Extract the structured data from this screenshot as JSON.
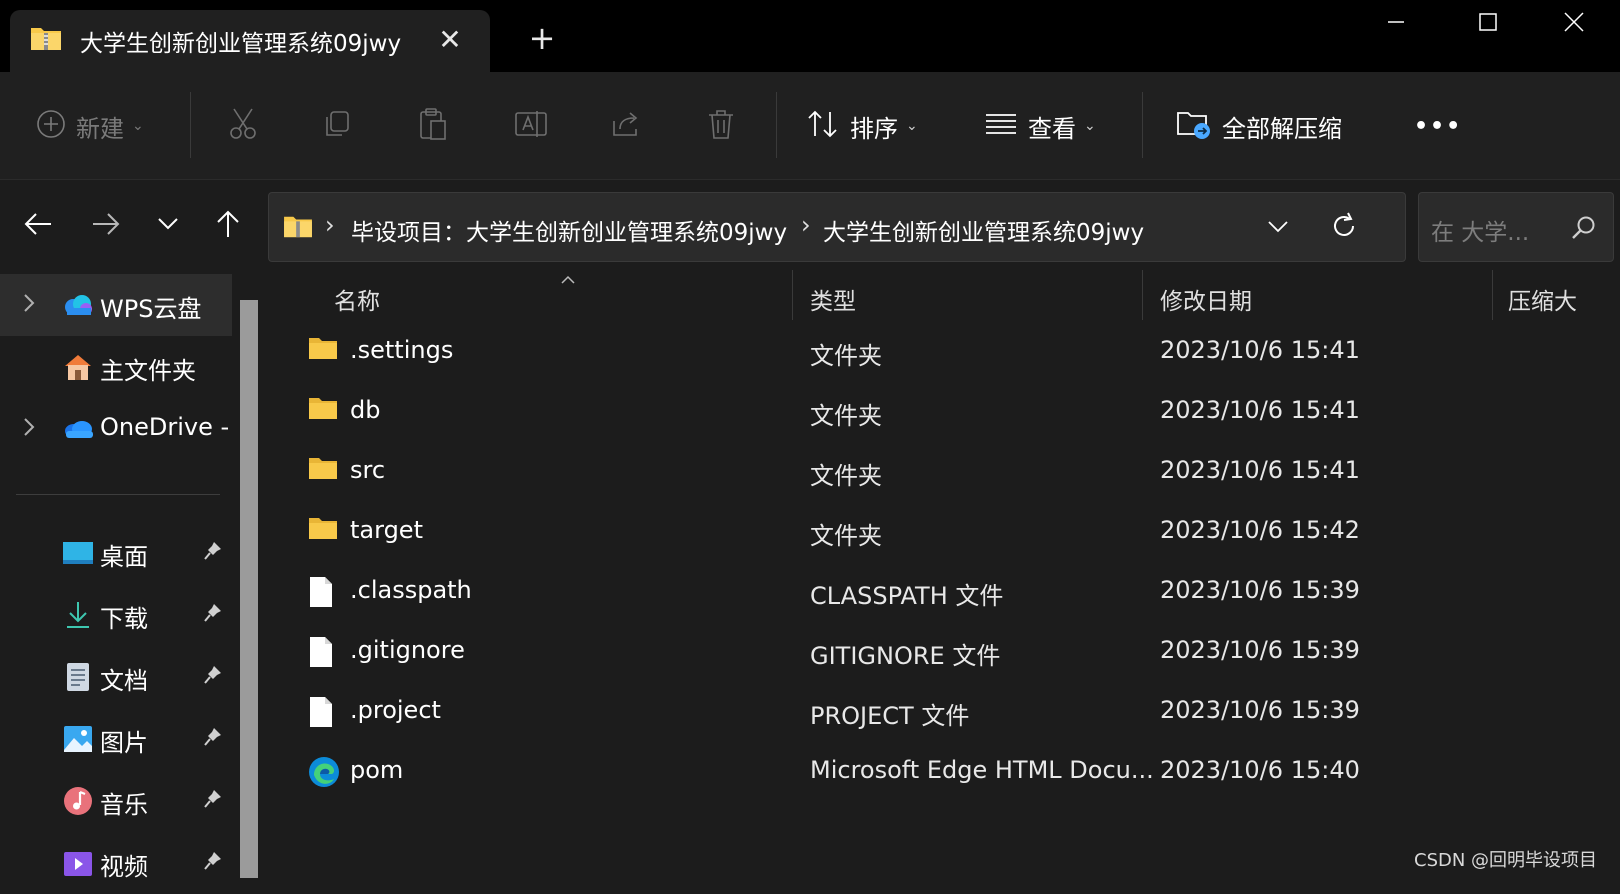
{
  "window": {
    "tab_title": "大学生创新创业管理系统09jwy",
    "tab_close": "✕",
    "new_tab": "+"
  },
  "toolbar": {
    "new_label": "新建",
    "sort_label": "排序",
    "view_label": "查看",
    "extract_label": "全部解压缩",
    "more_label": "•••"
  },
  "address": {
    "crumbs": [
      "毕设项目：大学生创新创业管理系统09jwy",
      "大学生创新创业管理系统09jwy"
    ],
    "separator": "›",
    "search_placeholder": "在 大学..."
  },
  "sidebar": {
    "items": [
      {
        "label": "WPS云盘",
        "icon": "wps-cloud-icon"
      },
      {
        "label": "主文件夹",
        "icon": "home-icon"
      },
      {
        "label": "OneDrive -",
        "icon": "onedrive-icon"
      },
      {
        "label": "桌面",
        "icon": "desktop-icon"
      },
      {
        "label": "下载",
        "icon": "download-icon"
      },
      {
        "label": "文档",
        "icon": "documents-icon"
      },
      {
        "label": "图片",
        "icon": "pictures-icon"
      },
      {
        "label": "音乐",
        "icon": "music-icon"
      },
      {
        "label": "视频",
        "icon": "videos-icon"
      }
    ]
  },
  "columns": {
    "name": "名称",
    "type": "类型",
    "date": "修改日期",
    "size": "压缩大"
  },
  "files": [
    {
      "name": ".settings",
      "type": "文件夹",
      "date": "2023/10/6 15:41",
      "icon": "folder-icon"
    },
    {
      "name": "db",
      "type": "文件夹",
      "date": "2023/10/6 15:41",
      "icon": "folder-icon"
    },
    {
      "name": "src",
      "type": "文件夹",
      "date": "2023/10/6 15:41",
      "icon": "folder-icon"
    },
    {
      "name": "target",
      "type": "文件夹",
      "date": "2023/10/6 15:42",
      "icon": "folder-icon"
    },
    {
      "name": ".classpath",
      "type": "CLASSPATH 文件",
      "date": "2023/10/6 15:39",
      "icon": "file-icon"
    },
    {
      "name": ".gitignore",
      "type": "GITIGNORE 文件",
      "date": "2023/10/6 15:39",
      "icon": "file-icon"
    },
    {
      "name": ".project",
      "type": "PROJECT 文件",
      "date": "2023/10/6 15:39",
      "icon": "file-icon"
    },
    {
      "name": "pom",
      "type": "Microsoft Edge HTML Docu...",
      "date": "2023/10/6 15:40",
      "icon": "edge-icon"
    }
  ],
  "watermark": "CSDN @回明毕设项目",
  "colors": {
    "accent_folder": "#f8c94a",
    "background": "#1c1c1c",
    "titlebar": "#000000"
  }
}
